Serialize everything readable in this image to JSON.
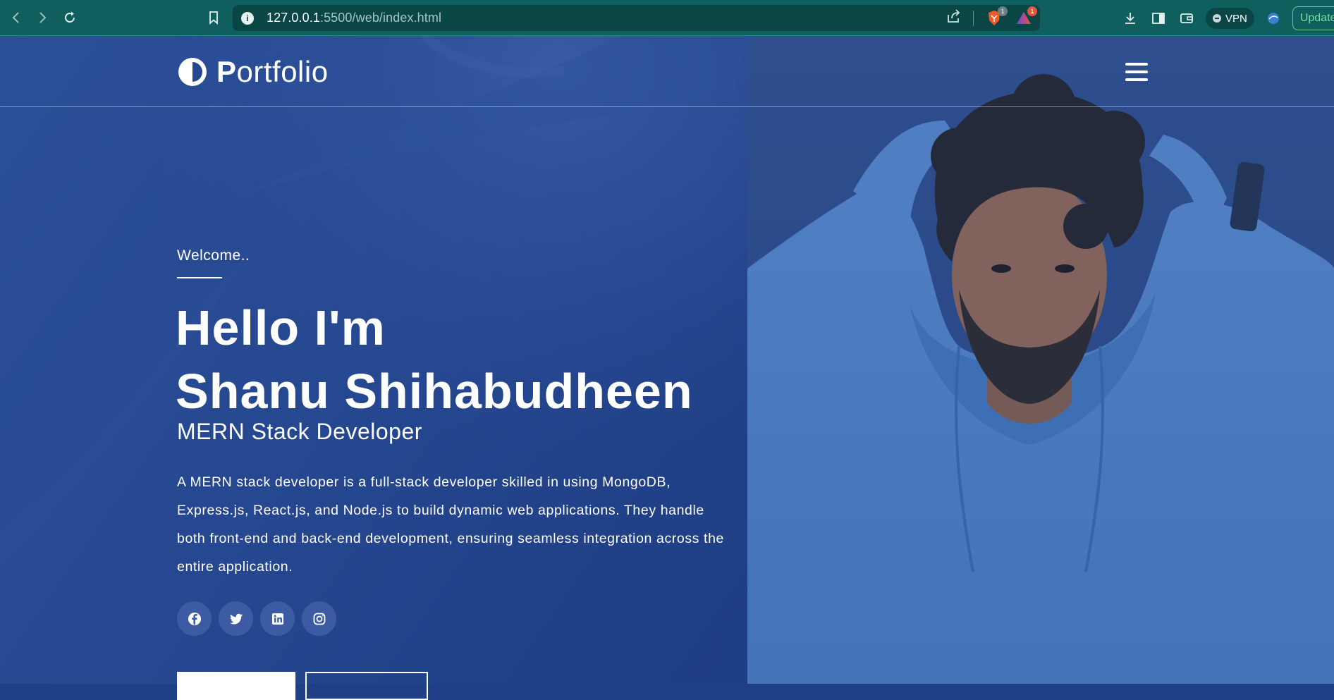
{
  "browser": {
    "url_host": "127.0.0.1",
    "url_path": ":5500/web/index.html",
    "badges": {
      "brave_count": "1",
      "rewards_count": "1"
    },
    "vpn_label": "VPN",
    "update_label": "Update"
  },
  "header": {
    "logo_initial": "P",
    "logo_rest": "ortfolio"
  },
  "hero": {
    "welcome": "Welcome..",
    "headline_line1": "Hello I'm",
    "headline_line2": "Shanu Shihabudheen",
    "role": "MERN Stack Developer",
    "bio": "A MERN stack developer is a full-stack developer skilled in using MongoDB, Express.js, React.js, and Node.js to build dynamic web applications. They handle both front-end and back-end development, ensuring seamless integration across the entire application.",
    "socials": [
      {
        "icon": "facebook-icon"
      },
      {
        "icon": "twitter-icon"
      },
      {
        "icon": "linkedin-icon"
      },
      {
        "icon": "instagram-icon"
      }
    ]
  },
  "colors": {
    "browser_bar": "#0f5f5f",
    "hero_bg": "#1f3f86",
    "social_bg": "#3c5ba2",
    "update_green": "#6ee398"
  }
}
